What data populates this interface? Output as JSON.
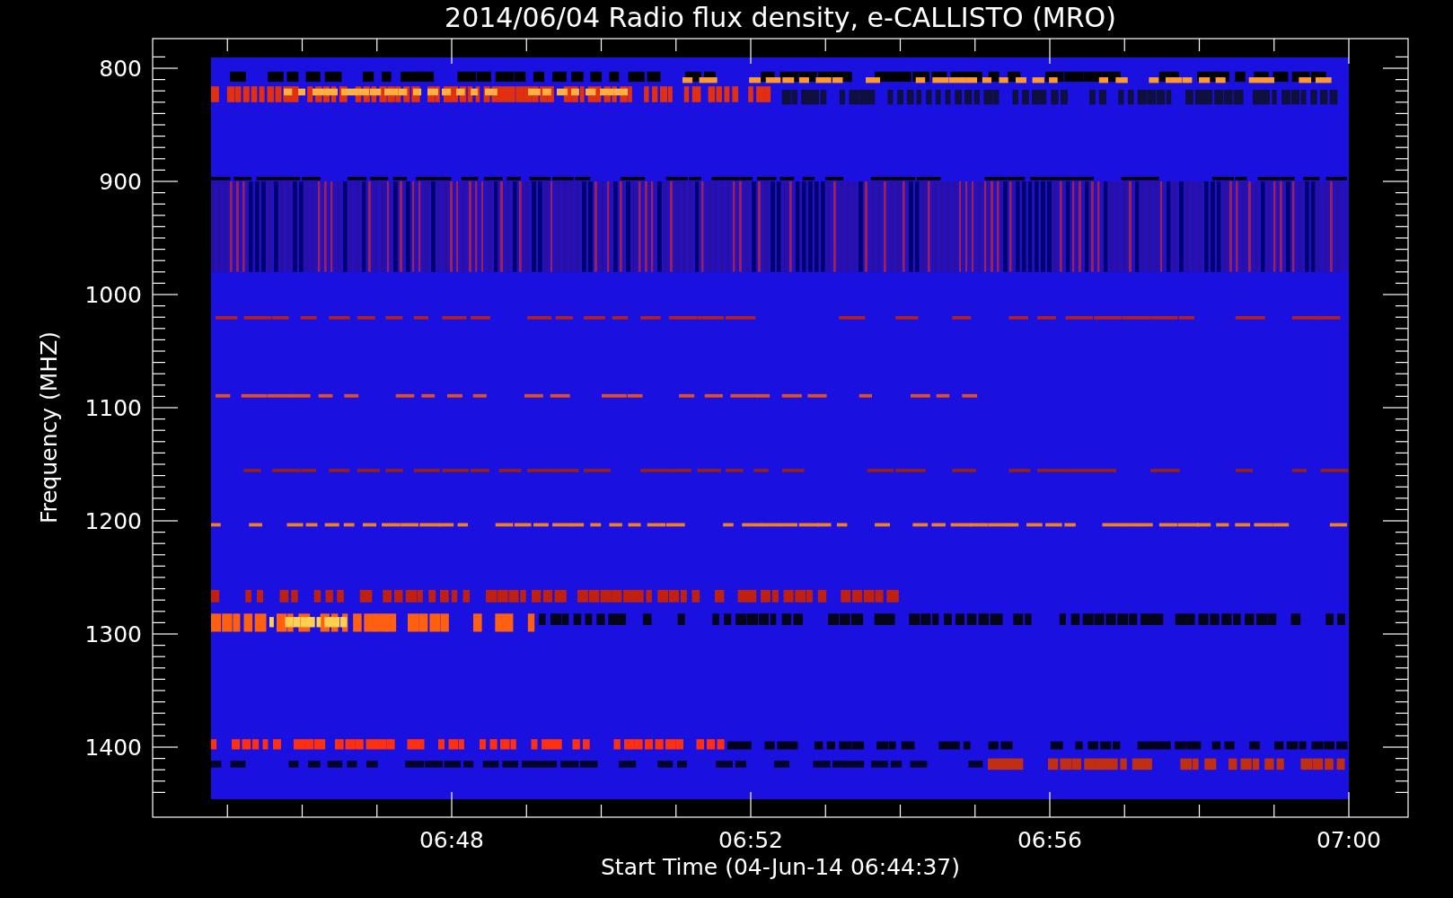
{
  "title": "2014/06/04  Radio flux density, e-CALLISTO (MRO)",
  "plot": {
    "ylabel": "Frequency (MHZ)",
    "xlabel": "Start Time (04-Jun-14 06:44:37)",
    "yticks": [
      "800",
      "900",
      "1000",
      "1100",
      "1200",
      "1300",
      "1400"
    ],
    "xticks": [
      "06:48",
      "06:52",
      "06:56",
      "07:00"
    ]
  }
}
